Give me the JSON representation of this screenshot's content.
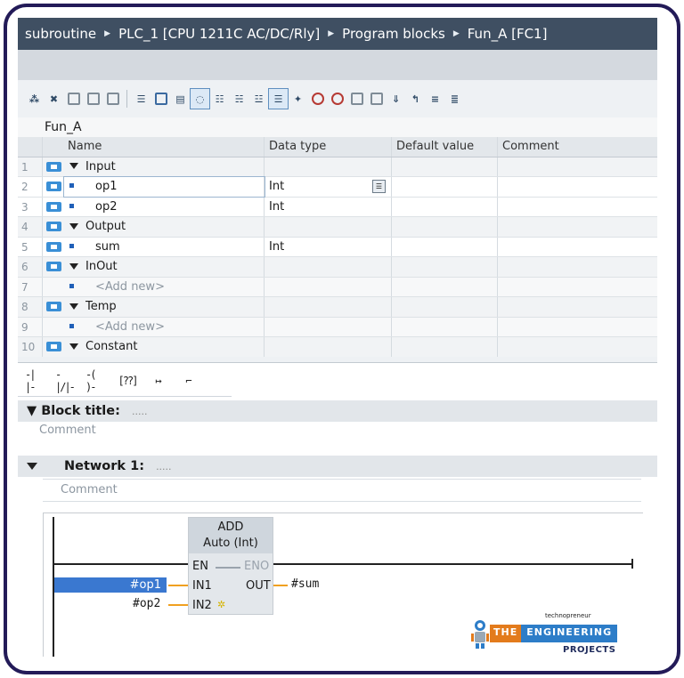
{
  "breadcrumb": {
    "items": [
      "subroutine",
      "PLC_1 [CPU 1211C AC/DC/Rly]",
      "Program blocks",
      "Fun_A [FC1]"
    ]
  },
  "toolbar": {
    "icons": [
      "insert-row-icon",
      "delete-row-icon",
      "disabled-1-icon",
      "disabled-2-icon",
      "monitor-icon",
      "align-left-icon",
      "network-icon",
      "collapse-icon",
      "comments-icon",
      "insert-icon",
      "remove-icon",
      "open-icon",
      "box-icon",
      "favorite-icon",
      "refresh-icon",
      "status-icon",
      "compare-icon",
      "download-icon",
      "link-icon",
      "left-icon",
      "right-icon",
      "more-icon"
    ]
  },
  "block_name": "Fun_A",
  "interface": {
    "headers": {
      "name": "Name",
      "data_type": "Data type",
      "default": "Default value",
      "comment": "Comment"
    },
    "rows": [
      {
        "num": "1",
        "kind": "section",
        "name": "Input",
        "type": ""
      },
      {
        "num": "2",
        "kind": "var",
        "name": "op1",
        "type": "Int",
        "editing": true
      },
      {
        "num": "3",
        "kind": "var",
        "name": "op2",
        "type": "Int"
      },
      {
        "num": "4",
        "kind": "section",
        "name": "Output",
        "type": ""
      },
      {
        "num": "5",
        "kind": "var",
        "name": "sum",
        "type": "Int"
      },
      {
        "num": "6",
        "kind": "section",
        "name": "InOut",
        "type": ""
      },
      {
        "num": "7",
        "kind": "add",
        "name": "<Add new>",
        "type": ""
      },
      {
        "num": "8",
        "kind": "section",
        "name": "Temp",
        "type": ""
      },
      {
        "num": "9",
        "kind": "add",
        "name": "<Add new>",
        "type": ""
      },
      {
        "num": "10",
        "kind": "section",
        "name": "Constant",
        "type": ""
      }
    ]
  },
  "palette": {
    "items": [
      "-| |-",
      "-|/|-",
      "-( )-",
      "[??]",
      "↦",
      "⌐"
    ]
  },
  "block_title": {
    "label": "Block title:",
    "dots": "....."
  },
  "block_comment": "Comment",
  "network": {
    "label": "Network 1:",
    "dots": ".....",
    "comment": "Comment"
  },
  "ladder": {
    "box_title": "ADD",
    "box_subtitle": "Auto (Int)",
    "pin_en": "EN",
    "pin_eno": "ENO",
    "pin_in1": "IN1",
    "pin_in2": "IN2",
    "pin_out": "OUT",
    "operand_in1": "#op1",
    "operand_in2": "#op2",
    "operand_out": "#sum"
  },
  "logo": {
    "tagline": "technopreneur",
    "word1": "THE",
    "word2": "ENGINEERING",
    "word3": "PROJECTS"
  },
  "colors": {
    "breadcrumb_bg": "#3f4f62",
    "frame_border": "#231b58",
    "selection_blue": "#3a78d0",
    "wire_orange": "#f0a020"
  }
}
